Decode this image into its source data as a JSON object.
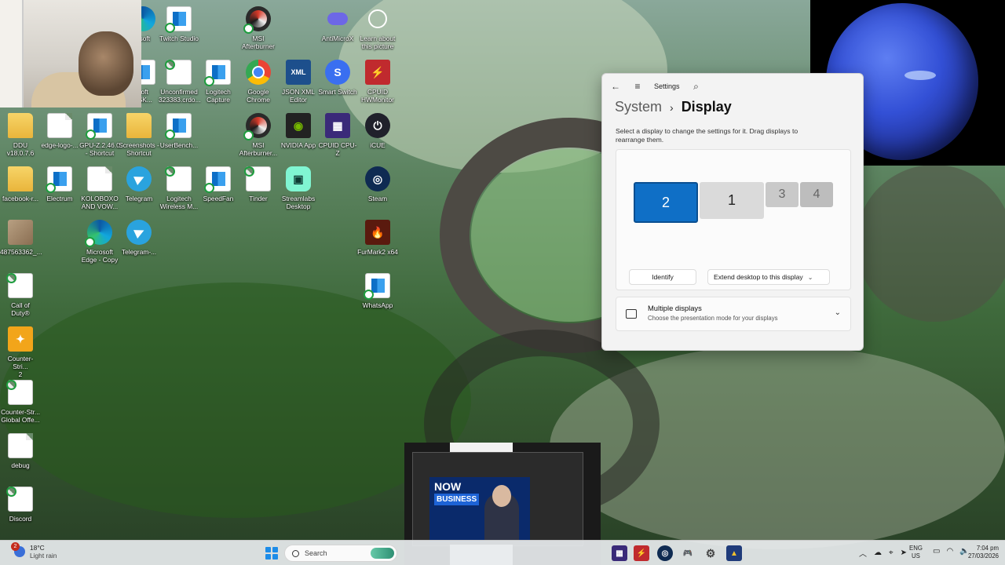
{
  "desktop": {
    "icons": [
      {
        "label": "Microsoft",
        "partial": "osoft"
      },
      {
        "label": "Twitch Studio"
      },
      {
        "label": "MSI\nAfterburner"
      },
      {
        "label": "AntiMicroX"
      },
      {
        "label": "Learn about\nthis picture"
      },
      {
        "label": "soft\nESK..."
      },
      {
        "label": "Unconfirmed\n323383.crdo..."
      },
      {
        "label": "Logitech\nCapture"
      },
      {
        "label": "Google\nChrome"
      },
      {
        "label": "JSON XML\nEditor"
      },
      {
        "label": "Smart Switch"
      },
      {
        "label": "CPUID\nHWMonitor"
      },
      {
        "label": "DDU v18.0.7.6"
      },
      {
        "label": "edge-logo-..."
      },
      {
        "label": "GPU-Z.2.46.0\n- Shortcut"
      },
      {
        "label": "Screenshots -\nShortcut"
      },
      {
        "label": "UserBench..."
      },
      {
        "label": "MSI\nAfterburner..."
      },
      {
        "label": "NVIDIA App"
      },
      {
        "label": "CPUID CPU-Z"
      },
      {
        "label": "iCUE"
      },
      {
        "label": "facebook-r..."
      },
      {
        "label": "Electrum"
      },
      {
        "label": "KOLOBOXO\nAND VOW..."
      },
      {
        "label": "Telegram"
      },
      {
        "label": "Logitech\nWireless M..."
      },
      {
        "label": "SpeedFan"
      },
      {
        "label": "Tinder"
      },
      {
        "label": "Streamlabs\nDesktop"
      },
      {
        "label": "Steam"
      },
      {
        "label": "487563362_..."
      },
      {
        "label": "Microsoft\nEdge - Copy"
      },
      {
        "label": "Telegram-..."
      },
      {
        "label": "FurMark2 x64"
      },
      {
        "label": "WhatsApp"
      },
      {
        "label": "Call of\nDuty®"
      },
      {
        "label": "Counter-Stri...\n2"
      },
      {
        "label": "Counter-Str...\nGlobal Offe..."
      },
      {
        "label": "debug"
      },
      {
        "label": "Discord"
      }
    ]
  },
  "settings": {
    "window_title": "Settings",
    "breadcrumb_parent": "System",
    "breadcrumb_sep": "›",
    "breadcrumb_current": "Display",
    "instruction": "Select a display to change the settings for it. Drag displays to rearrange them.",
    "monitors": [
      "2",
      "1",
      "3",
      "4"
    ],
    "selected_monitor": "2",
    "identify_label": "Identify",
    "extend_label": "Extend desktop to this display",
    "multiple_displays_title": "Multiple displays",
    "multiple_displays_desc": "Choose the presentation mode for your displays"
  },
  "video": {
    "news_line1": "NOW",
    "news_line2": "BUSINESS"
  },
  "taskbar": {
    "weather_temp": "18°C",
    "weather_cond": "Light rain",
    "weather_badge": "2",
    "search_label": "Search",
    "lang_line1": "ENG",
    "lang_line2": "US",
    "time": "7:04 pm",
    "date": "27/03/2026",
    "colors": {
      "accent": "#0f6fc6",
      "taskbar_bg": "#e8ecee"
    }
  }
}
